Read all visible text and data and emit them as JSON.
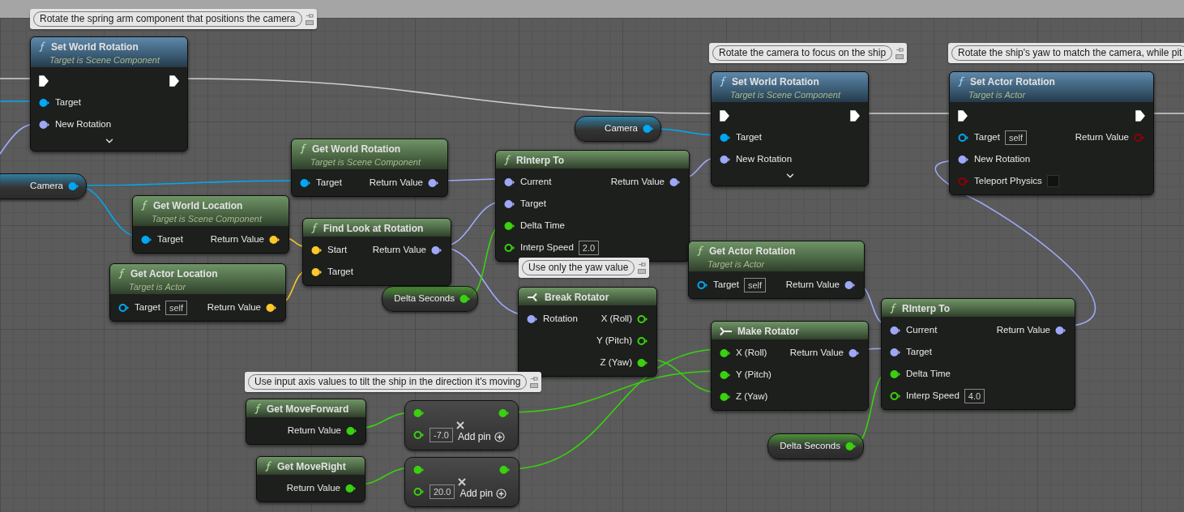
{
  "comments": [
    {
      "text": "Rotate the spring arm component that positions the camera"
    },
    {
      "text": "Rotate the camera to focus on the ship"
    },
    {
      "text": "Rotate the ship's yaw to match the camera, while pit"
    },
    {
      "text": "Use only the yaw value"
    },
    {
      "text": "Use input axis values to tilt the ship in the direction it's moving"
    }
  ],
  "nodes": [
    {
      "kind": "call",
      "title": "Set World Rotation",
      "subtitle": "Target is Scene Component",
      "expandable": true,
      "inputs": [
        {
          "kind": "exec",
          "connected": true
        },
        {
          "label": "Target",
          "kind": "data",
          "color": "#00a8f4",
          "connected": true
        },
        {
          "label": "New Rotation",
          "kind": "data",
          "color": "#9ea8f6",
          "connected": true
        }
      ],
      "outputs": [
        {
          "kind": "exec",
          "connected": true
        }
      ]
    },
    {
      "kind": "variable",
      "title": "Camera",
      "outputs": [
        {
          "kind": "data",
          "color": "#00a8f4",
          "connected": true
        }
      ]
    },
    {
      "kind": "pure",
      "title": "Get World Rotation",
      "subtitle": "Target is Scene Component",
      "inputs": [
        {
          "label": "Target",
          "kind": "data",
          "color": "#00a8f4",
          "connected": true
        }
      ],
      "outputs": [
        {
          "label": "Return Value",
          "kind": "data",
          "color": "#9ea8f6",
          "connected": true
        }
      ]
    },
    {
      "kind": "pure",
      "title": "Get World Location",
      "subtitle": "Target is Scene Component",
      "inputs": [
        {
          "label": "Target",
          "kind": "data",
          "color": "#00a8f4",
          "connected": true
        }
      ],
      "outputs": [
        {
          "label": "Return Value",
          "kind": "data",
          "color": "#fdc828",
          "connected": true
        }
      ]
    },
    {
      "kind": "pure",
      "title": "Find Look at Rotation",
      "inputs": [
        {
          "label": "Start",
          "kind": "data",
          "color": "#fdc828",
          "connected": true
        },
        {
          "label": "Target",
          "kind": "data",
          "color": "#fdc828",
          "connected": true
        }
      ],
      "outputs": [
        {
          "label": "Return Value",
          "kind": "data",
          "color": "#9ea8f6",
          "connected": true
        }
      ]
    },
    {
      "kind": "pure",
      "title": "Get Actor Location",
      "subtitle": "Target is Actor",
      "inputs": [
        {
          "label": "Target",
          "kind": "data",
          "color": "#00a8f4",
          "connected": false,
          "default": "self"
        }
      ],
      "outputs": [
        {
          "label": "Return Value",
          "kind": "data",
          "color": "#fdc828",
          "connected": true
        }
      ]
    },
    {
      "kind": "variable",
      "title": "Camera",
      "outputs": [
        {
          "kind": "data",
          "color": "#00a8f4",
          "connected": true
        }
      ]
    },
    {
      "kind": "pure",
      "title": "RInterp To",
      "inputs": [
        {
          "label": "Current",
          "kind": "data",
          "color": "#9ea8f6",
          "connected": true
        },
        {
          "label": "Target",
          "kind": "data",
          "color": "#9ea8f6",
          "connected": true
        },
        {
          "label": "Delta Time",
          "kind": "data",
          "color": "#3ad10f",
          "connected": true
        },
        {
          "label": "Interp Speed",
          "kind": "data",
          "color": "#3ad10f",
          "connected": false,
          "default": "2.0"
        }
      ],
      "outputs": [
        {
          "label": "Return Value",
          "kind": "data",
          "color": "#9ea8f6",
          "connected": true
        }
      ]
    },
    {
      "kind": "call",
      "title": "Set World Rotation",
      "subtitle": "Target is Scene Component",
      "expandable": true,
      "inputs": [
        {
          "kind": "exec",
          "connected": true
        },
        {
          "label": "Target",
          "kind": "data",
          "color": "#00a8f4",
          "connected": true
        },
        {
          "label": "New Rotation",
          "kind": "data",
          "color": "#9ea8f6",
          "connected": true
        }
      ],
      "outputs": [
        {
          "kind": "exec",
          "connected": true
        }
      ]
    },
    {
      "kind": "call",
      "title": "Set Actor Rotation",
      "subtitle": "Target is Actor",
      "inputs": [
        {
          "kind": "exec",
          "connected": true
        },
        {
          "label": "Target",
          "kind": "data",
          "color": "#00a8f4",
          "connected": false,
          "default": "self"
        },
        {
          "label": "New Rotation",
          "kind": "data",
          "color": "#9ea8f6",
          "connected": true
        },
        {
          "label": "Teleport Physics",
          "kind": "data",
          "color": "#8f0000",
          "connected": false,
          "checked": false
        }
      ],
      "outputs": [
        {
          "kind": "exec",
          "connected": true
        },
        {
          "label": "Return Value",
          "kind": "data",
          "color": "#8f0000",
          "connected": false
        }
      ]
    },
    {
      "kind": "variable",
      "title": "Delta Seconds",
      "outputs": [
        {
          "kind": "data",
          "color": "#3ad10f",
          "connected": true
        }
      ]
    },
    {
      "kind": "break",
      "title": "Break Rotator",
      "inputs": [
        {
          "label": "Rotation",
          "kind": "data",
          "color": "#9ea8f6",
          "connected": true
        }
      ],
      "outputs": [
        {
          "label": "X (Roll)",
          "kind": "data",
          "color": "#3ad10f",
          "connected": false
        },
        {
          "label": "Y (Pitch)",
          "kind": "data",
          "color": "#3ad10f",
          "connected": false
        },
        {
          "label": "Z (Yaw)",
          "kind": "data",
          "color": "#3ad10f",
          "connected": true
        }
      ]
    },
    {
      "kind": "pure",
      "title": "Get Actor Rotation",
      "subtitle": "Target is Actor",
      "inputs": [
        {
          "label": "Target",
          "kind": "data",
          "color": "#00a8f4",
          "connected": false,
          "default": "self"
        }
      ],
      "outputs": [
        {
          "label": "Return Value",
          "kind": "data",
          "color": "#9ea8f6",
          "connected": true
        }
      ]
    },
    {
      "kind": "make",
      "title": "Make Rotator",
      "inputs": [
        {
          "label": "X (Roll)",
          "kind": "data",
          "color": "#3ad10f",
          "connected": true
        },
        {
          "label": "Y (Pitch)",
          "kind": "data",
          "color": "#3ad10f",
          "connected": true
        },
        {
          "label": "Z (Yaw)",
          "kind": "data",
          "color": "#3ad10f",
          "connected": true
        }
      ],
      "outputs": [
        {
          "label": "Return Value",
          "kind": "data",
          "color": "#9ea8f6",
          "connected": true
        }
      ]
    },
    {
      "kind": "pure",
      "title": "RInterp To",
      "inputs": [
        {
          "label": "Current",
          "kind": "data",
          "color": "#9ea8f6",
          "connected": true
        },
        {
          "label": "Target",
          "kind": "data",
          "color": "#9ea8f6",
          "connected": true
        },
        {
          "label": "Delta Time",
          "kind": "data",
          "color": "#3ad10f",
          "connected": true
        },
        {
          "label": "Interp Speed",
          "kind": "data",
          "color": "#3ad10f",
          "connected": false,
          "default": "4.0"
        }
      ],
      "outputs": [
        {
          "label": "Return Value",
          "kind": "data",
          "color": "#9ea8f6",
          "connected": true
        }
      ]
    },
    {
      "kind": "pure",
      "title": "Get MoveForward",
      "outputs": [
        {
          "label": "Return Value",
          "kind": "data",
          "color": "#3ad10f",
          "connected": true
        }
      ]
    },
    {
      "kind": "math",
      "add_pin": "Add pin",
      "inputs": [
        {
          "kind": "data",
          "color": "#3ad10f",
          "connected": true
        },
        {
          "kind": "data",
          "color": "#3ad10f",
          "connected": false,
          "default": "-7.0"
        }
      ],
      "outputs": [
        {
          "kind": "data",
          "color": "#3ad10f",
          "connected": true
        }
      ]
    },
    {
      "kind": "pure",
      "title": "Get MoveRight",
      "outputs": [
        {
          "label": "Return Value",
          "kind": "data",
          "color": "#3ad10f",
          "connected": true
        }
      ]
    },
    {
      "kind": "math",
      "add_pin": "Add pin",
      "inputs": [
        {
          "kind": "data",
          "color": "#3ad10f",
          "connected": true
        },
        {
          "kind": "data",
          "color": "#3ad10f",
          "connected": false,
          "default": "20.0"
        }
      ],
      "outputs": [
        {
          "kind": "data",
          "color": "#3ad10f",
          "connected": true
        }
      ]
    },
    {
      "kind": "variable",
      "title": "Delta Seconds",
      "outputs": [
        {
          "kind": "data",
          "color": "#3ad10f",
          "connected": true
        }
      ]
    }
  ]
}
